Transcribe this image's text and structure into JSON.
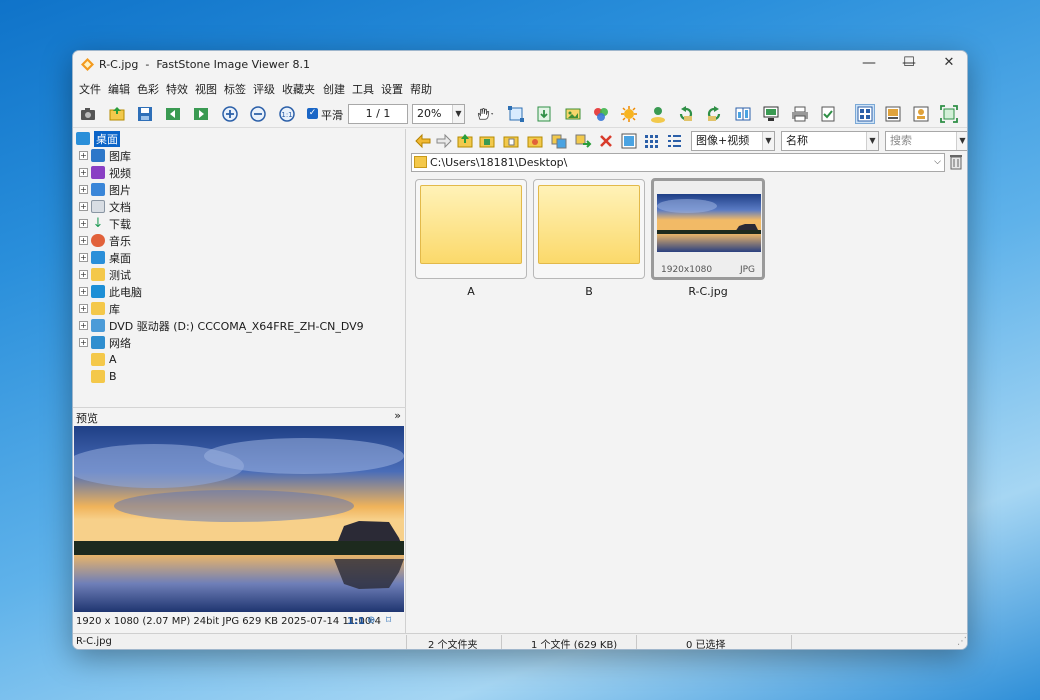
{
  "window": {
    "title": "R-C.jpg  -  FastStone Image Viewer 8.1",
    "minimize": "—",
    "maximize": "☐",
    "close": "✕"
  },
  "menu": [
    "文件",
    "编辑",
    "色彩",
    "特效",
    "视图",
    "标签",
    "评级",
    "收藏夹",
    "创建",
    "工具",
    "设置",
    "帮助"
  ],
  "toolbar": {
    "smooth_label": "平滑",
    "smooth_checked": true,
    "page_value": "1 / 1",
    "zoom_value": "20%"
  },
  "tree": {
    "items": [
      {
        "label": "桌面",
        "icon": "desktop-icon",
        "selected": true
      },
      {
        "label": "图库",
        "icon": "gallery-icon"
      },
      {
        "label": "视频",
        "icon": "video-icon"
      },
      {
        "label": "图片",
        "icon": "pictures-icon"
      },
      {
        "label": "文档",
        "icon": "documents-icon"
      },
      {
        "label": "下载",
        "icon": "download-icon"
      },
      {
        "label": "音乐",
        "icon": "music-icon"
      },
      {
        "label": "桌面",
        "icon": "desktop-icon"
      },
      {
        "label": "测试",
        "icon": "folder-icon"
      },
      {
        "label": "此电脑",
        "icon": "computer-icon"
      },
      {
        "label": "库",
        "icon": "library-icon"
      },
      {
        "label": "DVD 驱动器 (D:) CCCOMA_X64FRE_ZH-CN_DV9",
        "icon": "dvd-drive-icon"
      },
      {
        "label": "网络",
        "icon": "network-icon"
      },
      {
        "label": "A",
        "icon": "folder-icon"
      },
      {
        "label": "B",
        "icon": "folder-icon"
      }
    ]
  },
  "preview": {
    "title": "预览",
    "collapse": "»",
    "info": "1920 x 1080 (2.07 MP)  24bit  JPG   629 KB   2025-07-14 11:00:4",
    "ratio": "1:1"
  },
  "browser": {
    "view_mode": "图像+视频",
    "sort_by": "名称",
    "search_placeholder": "搜索",
    "path": "C:\\Users\\18181\\Desktop\\",
    "items": [
      {
        "name": "A",
        "type": "folder"
      },
      {
        "name": "B",
        "type": "folder"
      },
      {
        "name": "R-C.jpg",
        "type": "image",
        "resolution": "1920x1080",
        "format": "JPG",
        "selected": true
      }
    ]
  },
  "status": {
    "file": "R-C.jpg",
    "folders": "2 个文件夹",
    "files": "1 个文件 (629 KB)",
    "selected": "0 已选择"
  },
  "colors": {
    "selection": "#0a64c8",
    "folder": "#fbd96b",
    "accent": "#1a66c6"
  }
}
